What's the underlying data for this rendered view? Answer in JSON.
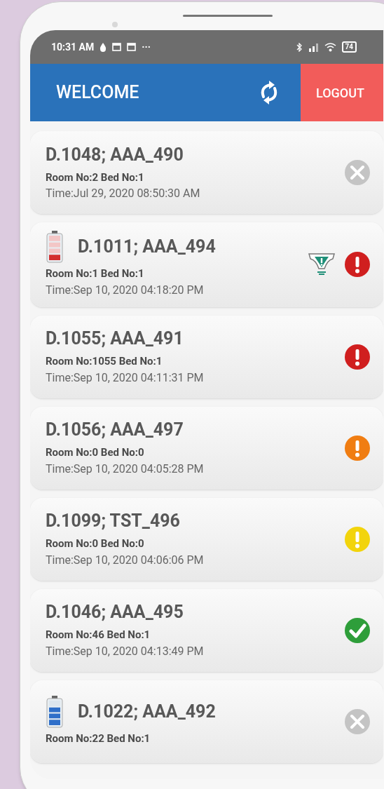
{
  "status_bar": {
    "time": "10:31 AM",
    "more": "···",
    "battery": "74"
  },
  "header": {
    "title": "WELCOME",
    "logout": "LOGOUT"
  },
  "devices": [
    {
      "title": "D.1048; AAA_490",
      "room": "Room No:2 Bed No:1",
      "time": "Time:Jul 29, 2020 08:50:30 AM",
      "diaper_alert": false,
      "kind": "offline"
    },
    {
      "title": "D.1011; AAA_494",
      "room": "Room No:1 Bed No:1",
      "time": "Time:Sep 10, 2020 04:18:20 PM",
      "battery": {
        "level": 0.25
      },
      "diaper_alert": true,
      "kind": "critical"
    },
    {
      "title": "D.1055; AAA_491",
      "room": "Room No:1055 Bed No:1",
      "time": "Time:Sep 10, 2020 04:11:31 PM",
      "diaper_alert": false,
      "kind": "critical"
    },
    {
      "title": "D.1056; AAA_497",
      "room": "Room No:0 Bed No:0",
      "time": "Time:Sep 10, 2020 04:05:28 PM",
      "diaper_alert": false,
      "kind": "warning"
    },
    {
      "title": "D.1099; TST_496",
      "room": "Room No:0 Bed No:0",
      "time": "Time:Sep 10, 2020 04:06:06 PM",
      "diaper_alert": false,
      "kind": "caution"
    },
    {
      "title": "D.1046; AAA_495",
      "room": "Room No:46 Bed No:1",
      "time": "Time:Sep 10, 2020 04:13:49 PM",
      "diaper_alert": false,
      "kind": "ok"
    },
    {
      "title": "D.1022; AAA_492",
      "room": "Room No:22 Bed No:1",
      "battery": {
        "level": 0.75
      },
      "diaper_alert": false,
      "kind": "offline"
    }
  ]
}
